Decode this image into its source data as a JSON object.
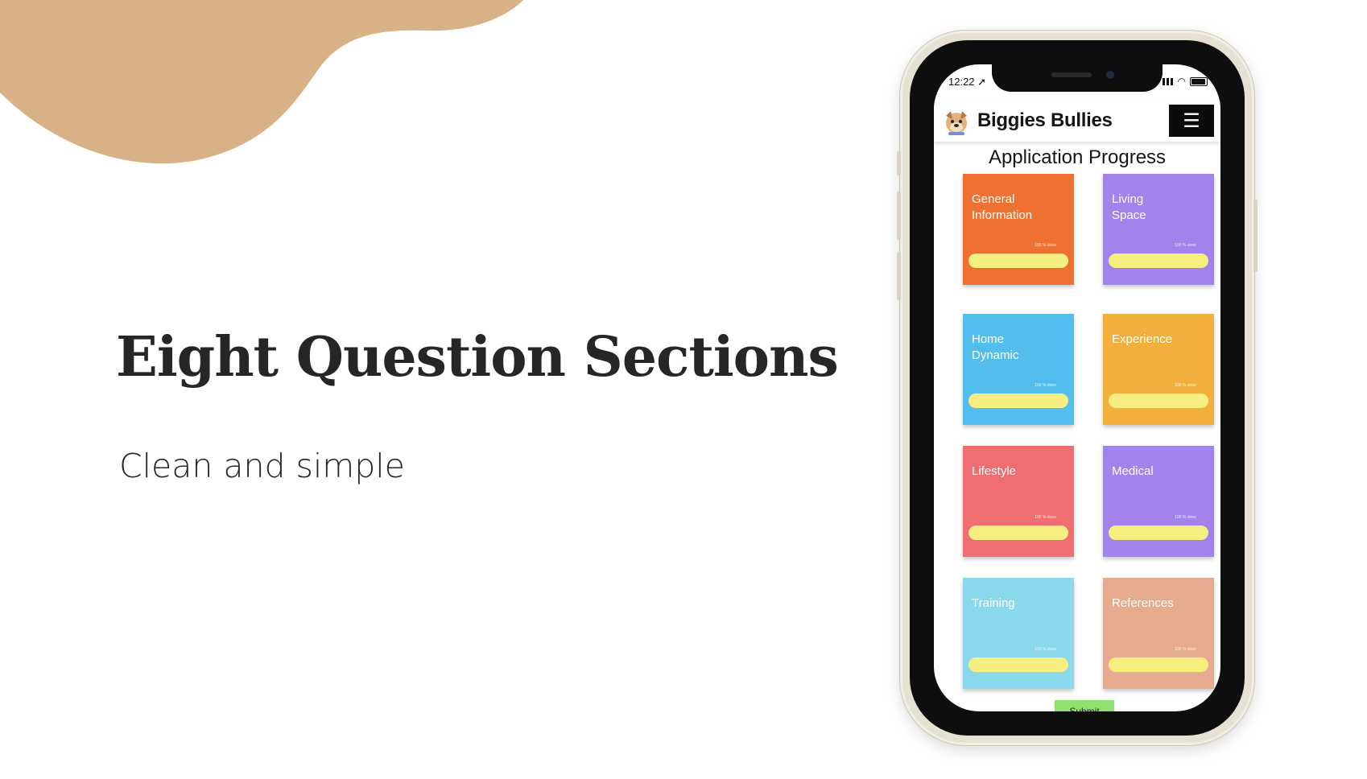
{
  "slide": {
    "headline": "Eight Question Sections",
    "subline": "Clean and simple"
  },
  "phone": {
    "status_time": "12:22 ➚",
    "app_name": "Biggies Bullies",
    "menu_icon": "☰",
    "page_title": "Application Progress",
    "submit_label": "Submit",
    "sections": [
      {
        "label": "General Information",
        "percent": "100 % done",
        "color": "#ef7132"
      },
      {
        "label": "Living Space",
        "percent": "100 % done",
        "color": "#a283ec"
      },
      {
        "label": "Home Dynamic",
        "percent": "100 % done",
        "color": "#53bdee"
      },
      {
        "label": "Experience",
        "percent": "100 % done",
        "color": "#f1b03b"
      },
      {
        "label": "Lifestyle",
        "percent": "100 % done",
        "color": "#ef6e72"
      },
      {
        "label": "Medical",
        "percent": "100 % done",
        "color": "#a283ec"
      },
      {
        "label": "Training",
        "percent": "100 % done",
        "color": "#8ad8ec"
      },
      {
        "label": "References",
        "percent": "100 % done",
        "color": "#e6ab8e"
      }
    ]
  },
  "colors": {
    "blob": "#d8b186",
    "progress_bar": "#f7ee80",
    "headline_text": "#262626"
  }
}
